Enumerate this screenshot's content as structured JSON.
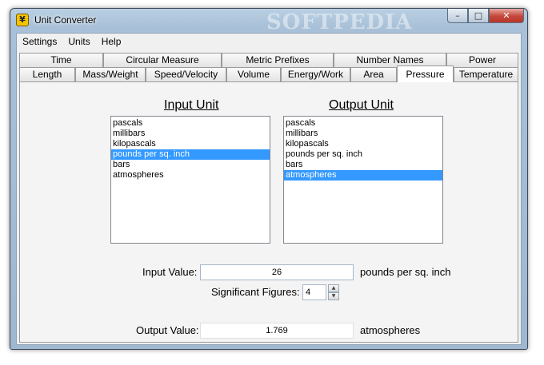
{
  "window": {
    "title": "Unit Converter",
    "watermark": "SOFTPEDIA",
    "controls": {
      "minimize": "–",
      "maximize": "□",
      "close": "✕"
    }
  },
  "menu": [
    "Settings",
    "Units",
    "Help"
  ],
  "tabs": {
    "row1": [
      "Time",
      "Circular Measure",
      "Metric Prefixes",
      "Number Names",
      "Power"
    ],
    "row2": [
      "Length",
      "Mass/Weight",
      "Speed/Velocity",
      "Volume",
      "Energy/Work",
      "Area",
      "Pressure",
      "Temperature"
    ],
    "active": "Pressure"
  },
  "input_unit": {
    "heading": "Input Unit",
    "items": [
      "pascals",
      "millibars",
      "kilopascals",
      "pounds per sq. inch",
      "bars",
      "atmospheres"
    ],
    "selected_index": 3
  },
  "output_unit": {
    "heading": "Output Unit",
    "items": [
      "pascals",
      "millibars",
      "kilopascals",
      "pounds per sq. inch",
      "bars",
      "atmospheres"
    ],
    "selected_index": 5
  },
  "input_value": {
    "label": "Input Value:",
    "value": "26",
    "unit": "pounds per sq. inch"
  },
  "significant_figures": {
    "label": "Significant Figures:",
    "value": "4",
    "up": "▲",
    "down": "▼"
  },
  "output_value": {
    "label": "Output Value:",
    "value": "1.769",
    "unit": "atmospheres"
  },
  "icons": {
    "app": "unit-converter-app-icon"
  }
}
